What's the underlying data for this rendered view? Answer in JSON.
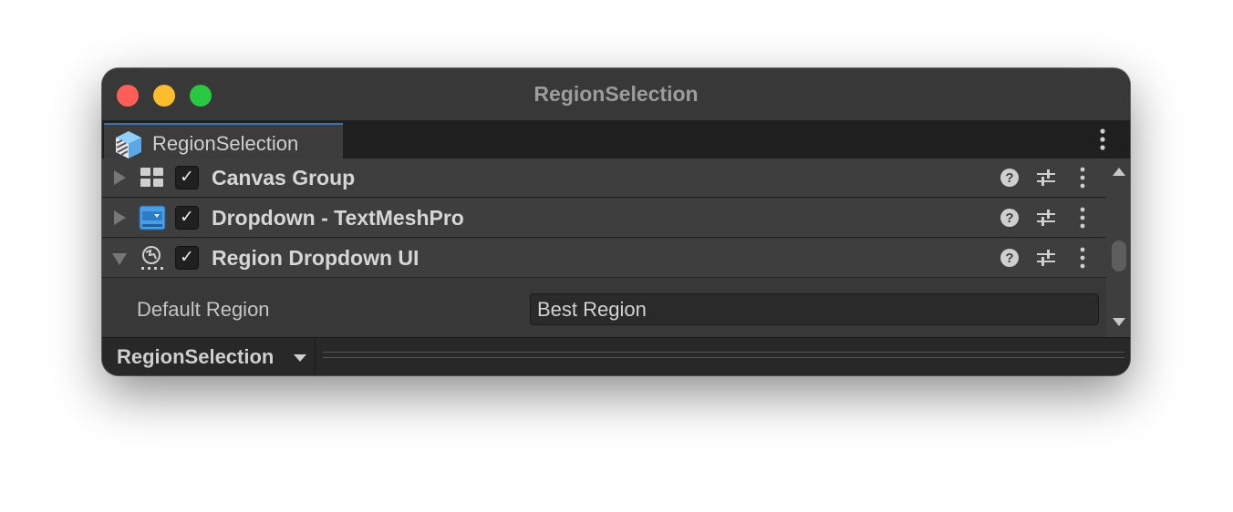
{
  "window": {
    "title": "RegionSelection"
  },
  "tab": {
    "label": "RegionSelection",
    "icon": "prefab-cube-icon"
  },
  "components": [
    {
      "label": "Canvas Group",
      "icon": "canvas-group-icon",
      "enabled": true,
      "expanded": false,
      "enabled_mark": "✓"
    },
    {
      "label": "Dropdown - TextMeshPro",
      "icon": "dropdown-icon",
      "enabled": true,
      "expanded": false,
      "enabled_mark": "✓"
    },
    {
      "label": "Region Dropdown UI",
      "icon": "script-icon",
      "enabled": true,
      "expanded": true,
      "enabled_mark": "✓"
    }
  ],
  "properties": [
    {
      "label": "Default Region",
      "value": "Best Region"
    }
  ],
  "bottom": {
    "dropdown_label": "RegionSelection"
  },
  "colors": {
    "accent": "#3a72b0",
    "close": "#ff5f57",
    "minimize": "#febc2e",
    "maximize": "#28c840"
  }
}
